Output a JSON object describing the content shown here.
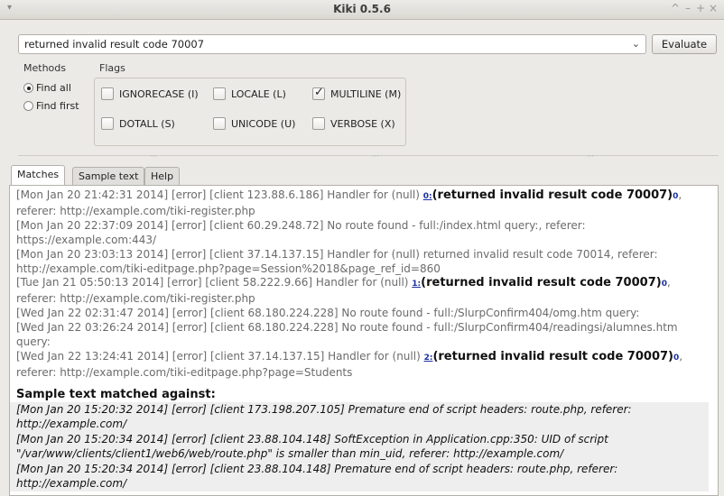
{
  "window": {
    "title": "Kiki 0.5.6",
    "controls": [
      "^",
      "–",
      "+",
      "×"
    ]
  },
  "regex_input": {
    "value": "returned invalid result code 70007"
  },
  "evaluate_label": "Evaluate",
  "methods": {
    "label": "Methods",
    "options": [
      {
        "label": "Find all",
        "selected": true
      },
      {
        "label": "Find first",
        "selected": false
      }
    ]
  },
  "flags": {
    "label": "Flags",
    "items": [
      {
        "label": "IGNORECASE (I)",
        "checked": false
      },
      {
        "label": "LOCALE (L)",
        "checked": false
      },
      {
        "label": "MULTILINE (M)",
        "checked": true
      },
      {
        "label": "DOTALL (S)",
        "checked": false
      },
      {
        "label": "UNICODE (U)",
        "checked": false
      },
      {
        "label": "VERBOSE (X)",
        "checked": false
      }
    ]
  },
  "tabs": [
    "Matches",
    "Sample text",
    "Help"
  ],
  "matches": {
    "l1a": "[Mon Jan 20 21:42:31 2014] [error] [client 123.88.6.186] Handler for (null) ",
    "g0": "0:",
    "m0": "(returned invalid result code 70007)",
    "e0": "0",
    "l1b": ", referer: http://example.com/tiki-register.php",
    "l2": "[Mon Jan 20 22:37:09 2014] [error] [client 60.29.248.72] No route found - full:/index.html query:, referer: https://example.com:443/",
    "l3": "[Mon Jan 20 23:03:13 2014] [error] [client 37.14.137.15] Handler for (null) returned invalid result code 70014, referer: http://example.com/tiki-editpage.php?page=Session%2018&page_ref_id=860",
    "l4a": "[Tue Jan 21 05:50:13 2014] [error] [client 58.222.9.66] Handler for (null) ",
    "g1": "1:",
    "m1": "(returned invalid result code 70007)",
    "e1": "0",
    "l4b": ", referer: http://example.com/tiki-register.php",
    "l5": "[Wed Jan 22 02:31:47 2014] [error] [client 68.180.224.228] No route found - full:/SlurpConfirm404/omg.htm query:",
    "l6": "[Wed Jan 22 03:26:24 2014] [error] [client 68.180.224.228] No route found - full:/SlurpConfirm404/readingsi/alumnes.htm query:",
    "l7a": "[Wed Jan 22 13:24:41 2014] [error] [client 37.14.137.15] Handler for (null) ",
    "g2": "2:",
    "m2": "(returned invalid result code 70007)",
    "e2": "0",
    "l7b": ", referer: http://example.com/tiki-editpage.php?page=Students"
  },
  "sample": {
    "title": "Sample text matched against:",
    "lines": [
      "[Mon Jan 20 15:20:32 2014] [error] [client 173.198.207.105] Premature end of script headers: route.php, referer: http://example.com/",
      "[Mon Jan 20 15:20:34 2014] [error] [client 23.88.104.148] SoftException in Application.cpp:350: UID of script \"/var/www/clients/client1/web6/web/route.php\" is smaller than min_uid, referer: http://example.com/",
      "[Mon Jan 20 15:20:34 2014] [error] [client 23.88.104.148] Premature end of script headers: route.php, referer: http://example.com/"
    ]
  }
}
